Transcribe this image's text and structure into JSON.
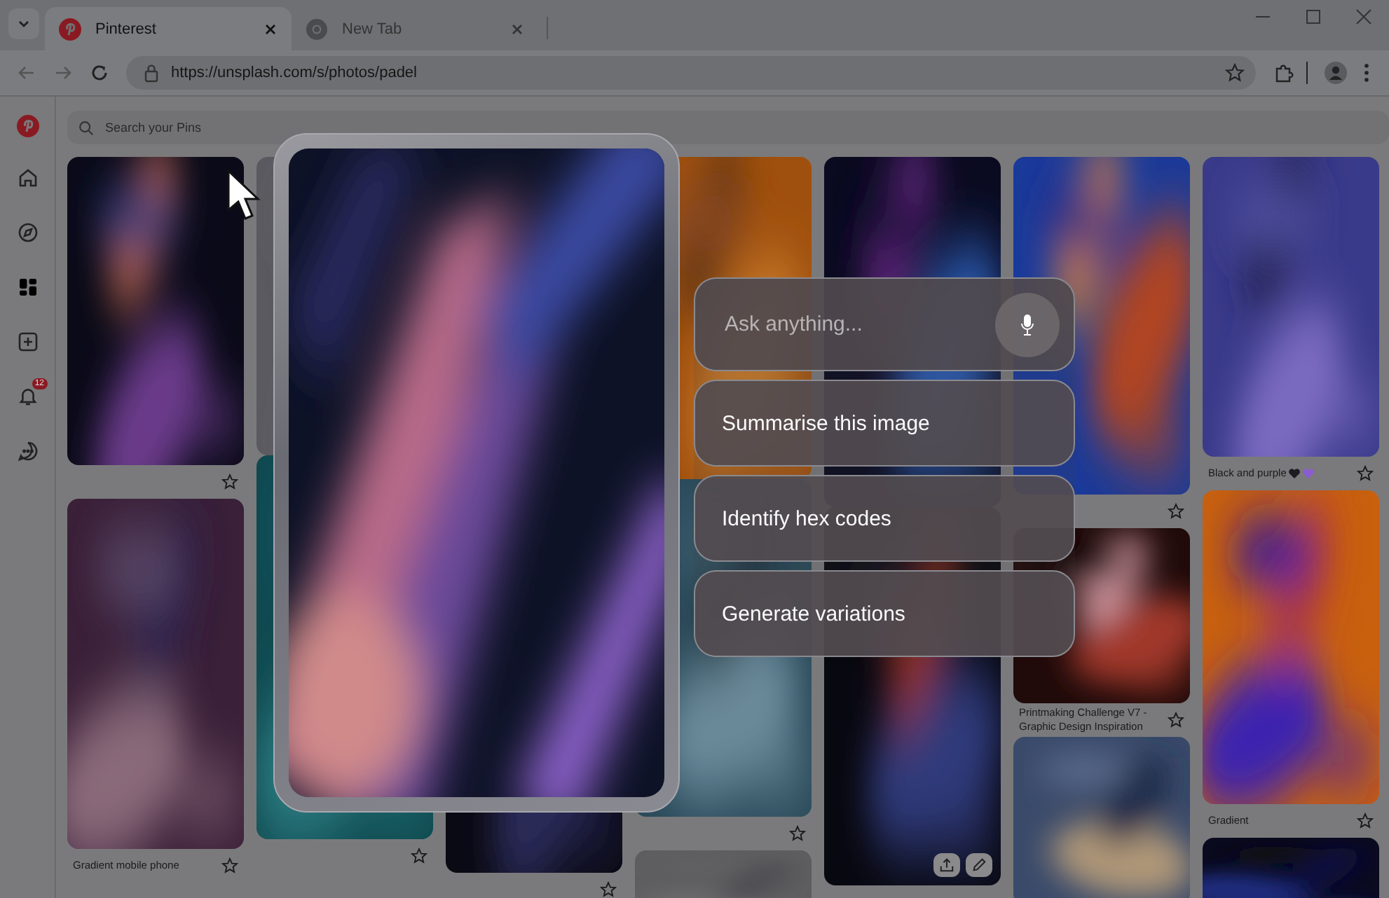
{
  "tabs": [
    {
      "label": "Pinterest",
      "kind": "pinterest",
      "selected": true
    },
    {
      "label": "New Tab",
      "kind": "chrome",
      "selected": false
    }
  ],
  "address_bar": {
    "url": "https://unsplash.com/s/photos/padel"
  },
  "sidebar": {
    "items": [
      {
        "kind": "home",
        "selected": false
      },
      {
        "kind": "explore",
        "selected": false
      },
      {
        "kind": "boards",
        "selected": true
      },
      {
        "kind": "create",
        "selected": false
      },
      {
        "kind": "notifications",
        "selected": false,
        "badge": "12"
      },
      {
        "kind": "messages",
        "selected": false
      }
    ]
  },
  "search": {
    "placeholder": "Search your Pins"
  },
  "columns": [
    {
      "pins": [
        {
          "star": true,
          "hovered": false
        },
        {
          "caption": "Gradient mobile phone",
          "star": true,
          "hovered": false
        }
      ]
    },
    {
      "pins": [
        {
          "star": false,
          "hovered": false
        },
        {
          "star": true,
          "hovered": false
        }
      ]
    },
    {
      "pins": [
        {
          "star": true,
          "hovered": false
        }
      ]
    },
    {
      "pins": [
        {
          "star": false,
          "hovered": false
        },
        {
          "star": true,
          "hovered": false
        },
        {
          "star": false,
          "hovered": false
        }
      ]
    },
    {
      "pins": [
        {
          "star": false,
          "hovered": false
        },
        {
          "star": false,
          "hovered": true
        }
      ]
    },
    {
      "pins": [
        {
          "star": true,
          "hovered": false
        },
        {
          "caption": "Printmaking Challenge V7 - Graphic Design Inspiration",
          "star": true,
          "hovered": false
        },
        {
          "star": false,
          "hovered": false
        }
      ]
    },
    {
      "pins": [
        {
          "caption": "Black and purple",
          "hearts": [
            {
              "color": "#1c1c22"
            },
            {
              "color": "#8a5cd0"
            }
          ],
          "star": true,
          "hovered": false
        },
        {
          "caption": "Gradient",
          "star": true,
          "hovered": false
        },
        {
          "star": false,
          "hovered": false
        }
      ]
    }
  ],
  "assistant": {
    "placeholder": "Ask anything...",
    "suggestions": [
      "Summarise this image",
      "Identify hex codes",
      "Generate variations"
    ]
  }
}
